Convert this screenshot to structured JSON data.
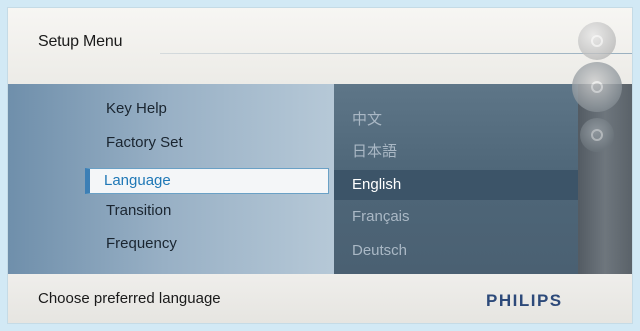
{
  "header": {
    "title": "Setup Menu"
  },
  "menu": {
    "items": [
      {
        "label": "Key Help"
      },
      {
        "label": "Factory Set"
      },
      {
        "label": "Language",
        "selected": true
      },
      {
        "label": "Transition"
      },
      {
        "label": "Frequency"
      }
    ]
  },
  "languages": {
    "items": [
      {
        "label": "中文"
      },
      {
        "label": "日本語"
      },
      {
        "label": "English",
        "selected": true
      },
      {
        "label": "Français"
      },
      {
        "label": "Deutsch"
      }
    ]
  },
  "footer": {
    "hint": "Choose preferred language",
    "brand": "PHILIPS"
  },
  "colors": {
    "selected_text": "#1f78b6",
    "brand": "#2d4a7a",
    "panel": "#4f6779"
  },
  "icons": [
    "settings-icon",
    "dial-icon",
    "button-icon"
  ]
}
